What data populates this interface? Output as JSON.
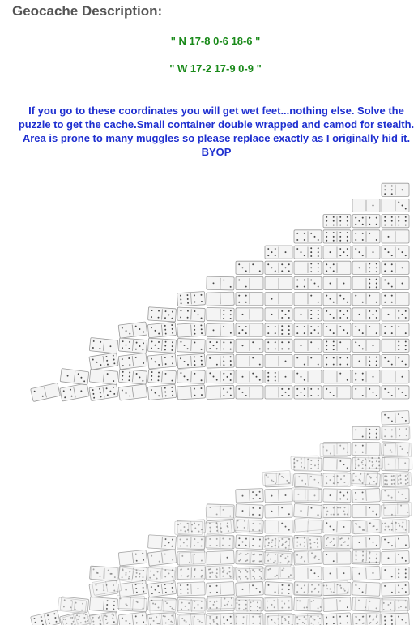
{
  "section": {
    "heading": "Geocache Description:"
  },
  "coordinates": {
    "north": "\" N 17-8 0-6 18-6 \"",
    "west": "\" W 17-2 17-9 0-9 \""
  },
  "description": {
    "text": "If you go to these coordinates you will get wet feet...nothing else. Solve the puzzle to get the cache.Small container double wrapped and camod for stealth. Area is prone to many muggles so please replace exactly as I originally hid it.",
    "signoff": "BYOP"
  },
  "colors": {
    "heading": "#555555",
    "coordinates": "#1a8a1a",
    "description": "#1e2fd0",
    "domino_face": "#f4f4f4",
    "domino_edge": "#9a9a9a",
    "pip": "#444444"
  },
  "puzzle": {
    "icon": "domino-tiles-image",
    "columns": 13,
    "rows": 14
  }
}
